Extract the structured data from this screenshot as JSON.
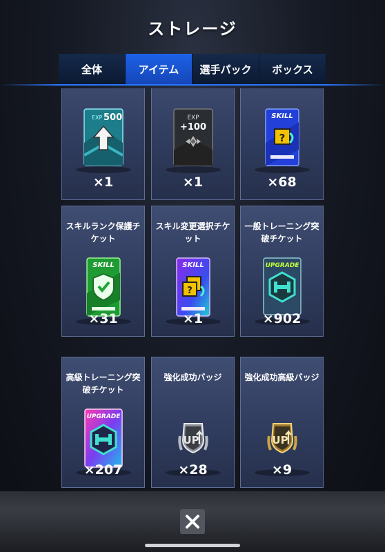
{
  "header": {
    "title": "ストレージ"
  },
  "tabs": [
    {
      "label": "全体",
      "active": false
    },
    {
      "label": "アイテム",
      "active": true
    },
    {
      "label": "選手パック",
      "active": false
    },
    {
      "label": "ボックス",
      "active": false
    }
  ],
  "items": [
    {
      "name": "",
      "count": "×1",
      "icon": "exp-500-upgrade-card-icon"
    },
    {
      "name": "",
      "count": "×1",
      "icon": "exp-100-card-icon"
    },
    {
      "name": "",
      "count": "×68",
      "icon": "skill-random-ticket-icon"
    },
    {
      "name": "スキルランク保護チケット",
      "count": "×31",
      "icon": "skill-shield-ticket-icon"
    },
    {
      "name": "スキル変更選択チケット",
      "count": "×1",
      "icon": "skill-change-ticket-icon"
    },
    {
      "name": "一般トレーニング突破チケット",
      "count": "×902",
      "icon": "upgrade-ticket-icon"
    },
    {
      "name": "高級トレーニング突破チケット",
      "count": "×207",
      "icon": "premium-upgrade-ticket-icon"
    },
    {
      "name": "強化成功バッジ",
      "count": "×28",
      "icon": "silver-up-badge-icon"
    },
    {
      "name": "強化成功高級バッジ",
      "count": "×9",
      "icon": "gold-up-badge-icon"
    }
  ],
  "art_text": {
    "exp500": "500",
    "exp100_label": "EXP",
    "exp100_value": "+100",
    "skill": "SKILL",
    "upgrade": "UPGRADE",
    "up": "UP"
  },
  "close": {
    "label": "×"
  }
}
